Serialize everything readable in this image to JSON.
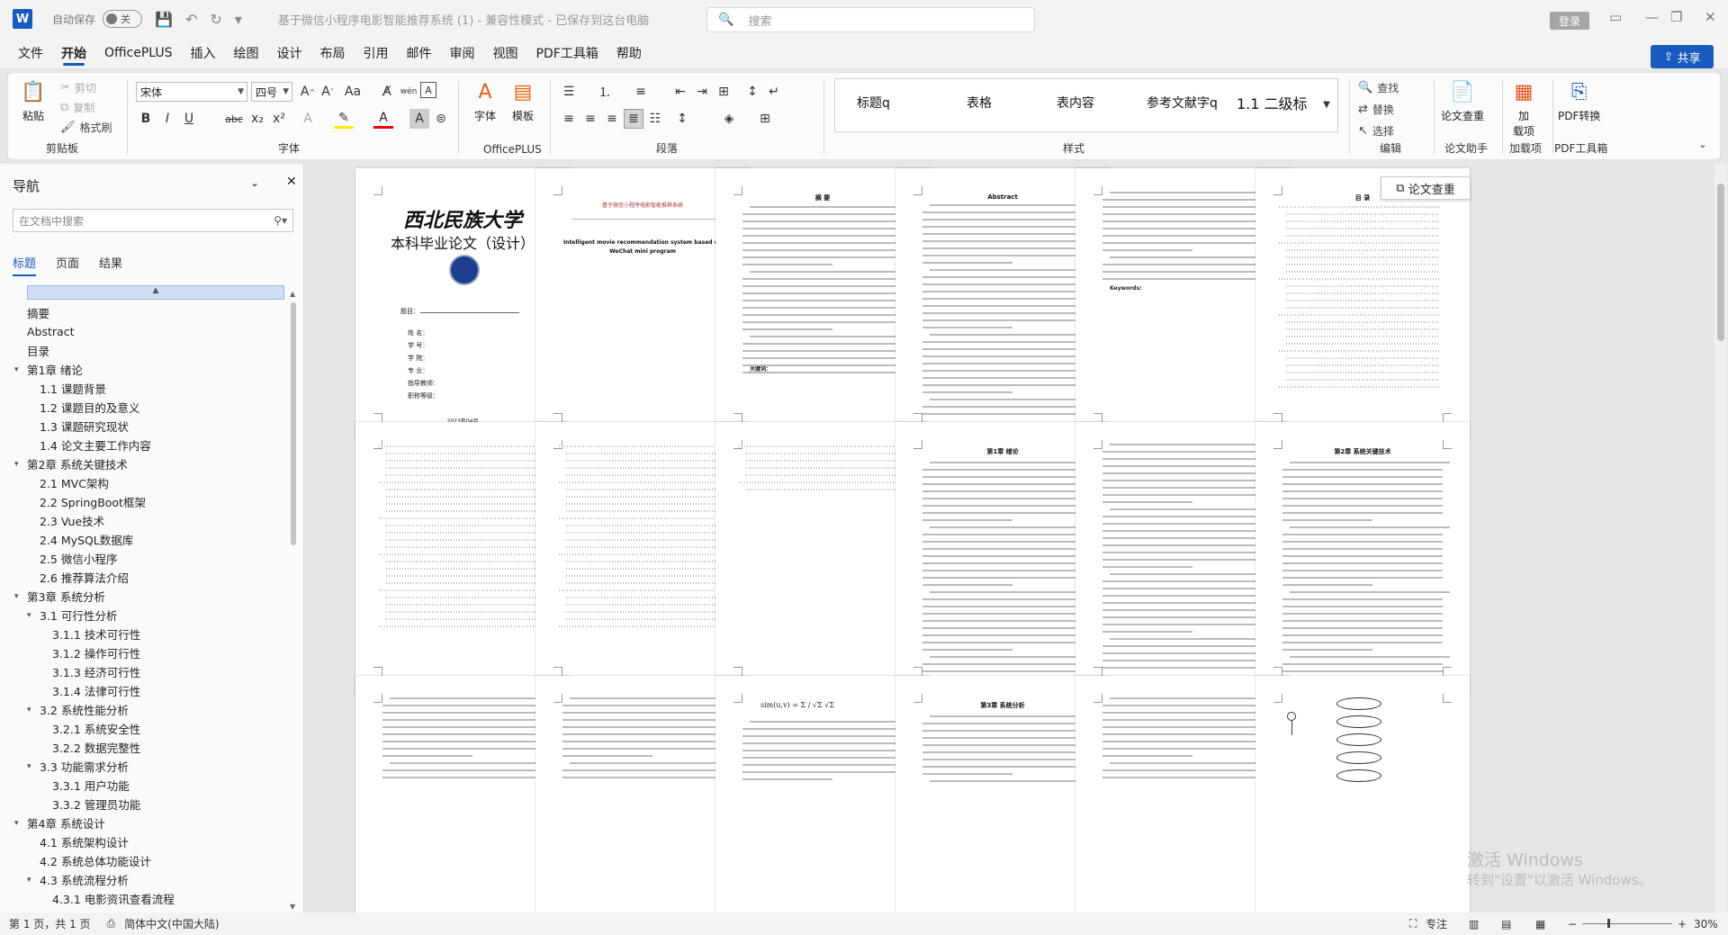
{
  "titlebar": {
    "app_icon": "W",
    "autosave_label": "自动保存",
    "autosave_state": "关",
    "doc_title": "基于微信小程序电影智能推荐系统 (1) - 兼容性模式 - 已保存到这台电脑",
    "search_placeholder": "搜索",
    "login_label": "登录",
    "icons": [
      "save-icon",
      "undo-icon",
      "redo-icon"
    ]
  },
  "menu": {
    "items": [
      "文件",
      "开始",
      "OfficePLUS",
      "插入",
      "绘图",
      "设计",
      "布局",
      "引用",
      "邮件",
      "审阅",
      "视图",
      "PDF工具箱",
      "帮助"
    ],
    "active": "开始",
    "share_label": "共享"
  },
  "ribbon": {
    "clipboard": {
      "paste": "粘贴",
      "cut": "剪切",
      "copy": "复制",
      "format_painter": "格式刷",
      "label": "剪贴板"
    },
    "font": {
      "font_name": "宋体",
      "font_size": "四号",
      "label": "字体",
      "buttons": [
        "B",
        "I",
        "U",
        "abc",
        "x₂",
        "x²",
        "A"
      ]
    },
    "officeplus": {
      "font_btn": "字体",
      "template_btn": "模板",
      "label": "OfficePLUS"
    },
    "paragraph": {
      "label": "段落"
    },
    "styles": {
      "items": [
        "标题q",
        "表格",
        "表内容",
        "参考文献字q",
        "1.1  二级标"
      ],
      "label": "样式"
    },
    "editing": {
      "find": "查找",
      "replace": "替换",
      "select": "选择",
      "label": "编辑"
    },
    "paper_check": {
      "btn": "论文查重",
      "label": "论文助手"
    },
    "addins": {
      "btn": "加\n载项",
      "label": "加载项"
    },
    "pdf": {
      "btn": "PDF转换",
      "label": "PDF工具箱"
    }
  },
  "nav": {
    "title": "导航",
    "search_placeholder": "在文档中搜索",
    "tabs": [
      "标题",
      "页面",
      "结果"
    ],
    "active_tab": "标题",
    "items": [
      {
        "label": "摘要",
        "level": 0,
        "toggle": ""
      },
      {
        "label": "Abstract",
        "level": 0,
        "toggle": ""
      },
      {
        "label": "目录",
        "level": 0,
        "toggle": ""
      },
      {
        "label": "第1章  绪论",
        "level": 0,
        "toggle": "▾"
      },
      {
        "label": "1.1 课题背景",
        "level": 1,
        "toggle": ""
      },
      {
        "label": "1.2 课题目的及意义",
        "level": 1,
        "toggle": ""
      },
      {
        "label": "1.3 课题研究现状",
        "level": 1,
        "toggle": ""
      },
      {
        "label": "1.4 论文主要工作内容",
        "level": 1,
        "toggle": ""
      },
      {
        "label": "第2章  系统关键技术",
        "level": 0,
        "toggle": "▾"
      },
      {
        "label": "2.1 MVC架构",
        "level": 1,
        "toggle": ""
      },
      {
        "label": "2.2  SpringBoot框架",
        "level": 1,
        "toggle": ""
      },
      {
        "label": "2.3  Vue技术",
        "level": 1,
        "toggle": ""
      },
      {
        "label": "2.4  MySQL数据库",
        "level": 1,
        "toggle": ""
      },
      {
        "label": "2.5 微信小程序",
        "level": 1,
        "toggle": ""
      },
      {
        "label": "2.6 推荐算法介绍",
        "level": 1,
        "toggle": ""
      },
      {
        "label": "第3章  系统分析",
        "level": 0,
        "toggle": "▾"
      },
      {
        "label": "3.1 可行性分析",
        "level": 1,
        "toggle": "▾"
      },
      {
        "label": "3.1.1 技术可行性",
        "level": 2,
        "toggle": ""
      },
      {
        "label": "3.1.2 操作可行性",
        "level": 2,
        "toggle": ""
      },
      {
        "label": "3.1.3 经济可行性",
        "level": 2,
        "toggle": ""
      },
      {
        "label": "3.1.4 法律可行性",
        "level": 2,
        "toggle": ""
      },
      {
        "label": "3.2 系统性能分析",
        "level": 1,
        "toggle": "▾"
      },
      {
        "label": "3.2.1 系统安全性",
        "level": 2,
        "toggle": ""
      },
      {
        "label": "3.2.2 数据完整性",
        "level": 2,
        "toggle": ""
      },
      {
        "label": "3.3 功能需求分析",
        "level": 1,
        "toggle": "▾"
      },
      {
        "label": "3.3.1 用户功能",
        "level": 2,
        "toggle": ""
      },
      {
        "label": "3.3.2 管理员功能",
        "level": 2,
        "toggle": ""
      },
      {
        "label": "第4章  系统设计",
        "level": 0,
        "toggle": "▾"
      },
      {
        "label": "4.1 系统架构设计",
        "level": 1,
        "toggle": ""
      },
      {
        "label": "4.2 系统总体功能设计",
        "level": 1,
        "toggle": ""
      },
      {
        "label": "4.3 系统流程分析",
        "level": 1,
        "toggle": "▾"
      },
      {
        "label": "4.3.1 电影资讯查看流程",
        "level": 2,
        "toggle": ""
      }
    ]
  },
  "pages": {
    "p1": {
      "university": "西北民族大学",
      "thesis": "本科毕业论文（设计）",
      "topic": "题目：",
      "fields": [
        "姓  名：",
        "学  号：",
        "学  院：",
        "专  业：",
        "指导教师：",
        "职称等级："
      ],
      "date": "2023年04月"
    },
    "p2": {
      "line": "基于微信小程序电影智能推荐系统",
      "en_title": "Intelligent movie recommendation system based on WeChat mini program"
    },
    "p3": {
      "title": "摘  要",
      "keywords": "关键词："
    },
    "p4": {
      "title": "Abstract"
    },
    "p5": {
      "keywords": "Keywords:"
    },
    "p6": {
      "title": "目  录"
    },
    "p10": {
      "title": "第1章  绪论"
    },
    "p12": {
      "title": "第2章  系统关键技术"
    },
    "p16": {
      "title": "第3章  系统分析"
    }
  },
  "popup": {
    "paper_check": "论文查重"
  },
  "watermark": {
    "line1": "激活 Windows",
    "line2": "转到\"设置\"以激活 Windows。"
  },
  "status": {
    "page": "第 1 页，共 1 页",
    "lang": "简体中文(中国大陆)",
    "focus": "专注",
    "zoom": "30%"
  }
}
